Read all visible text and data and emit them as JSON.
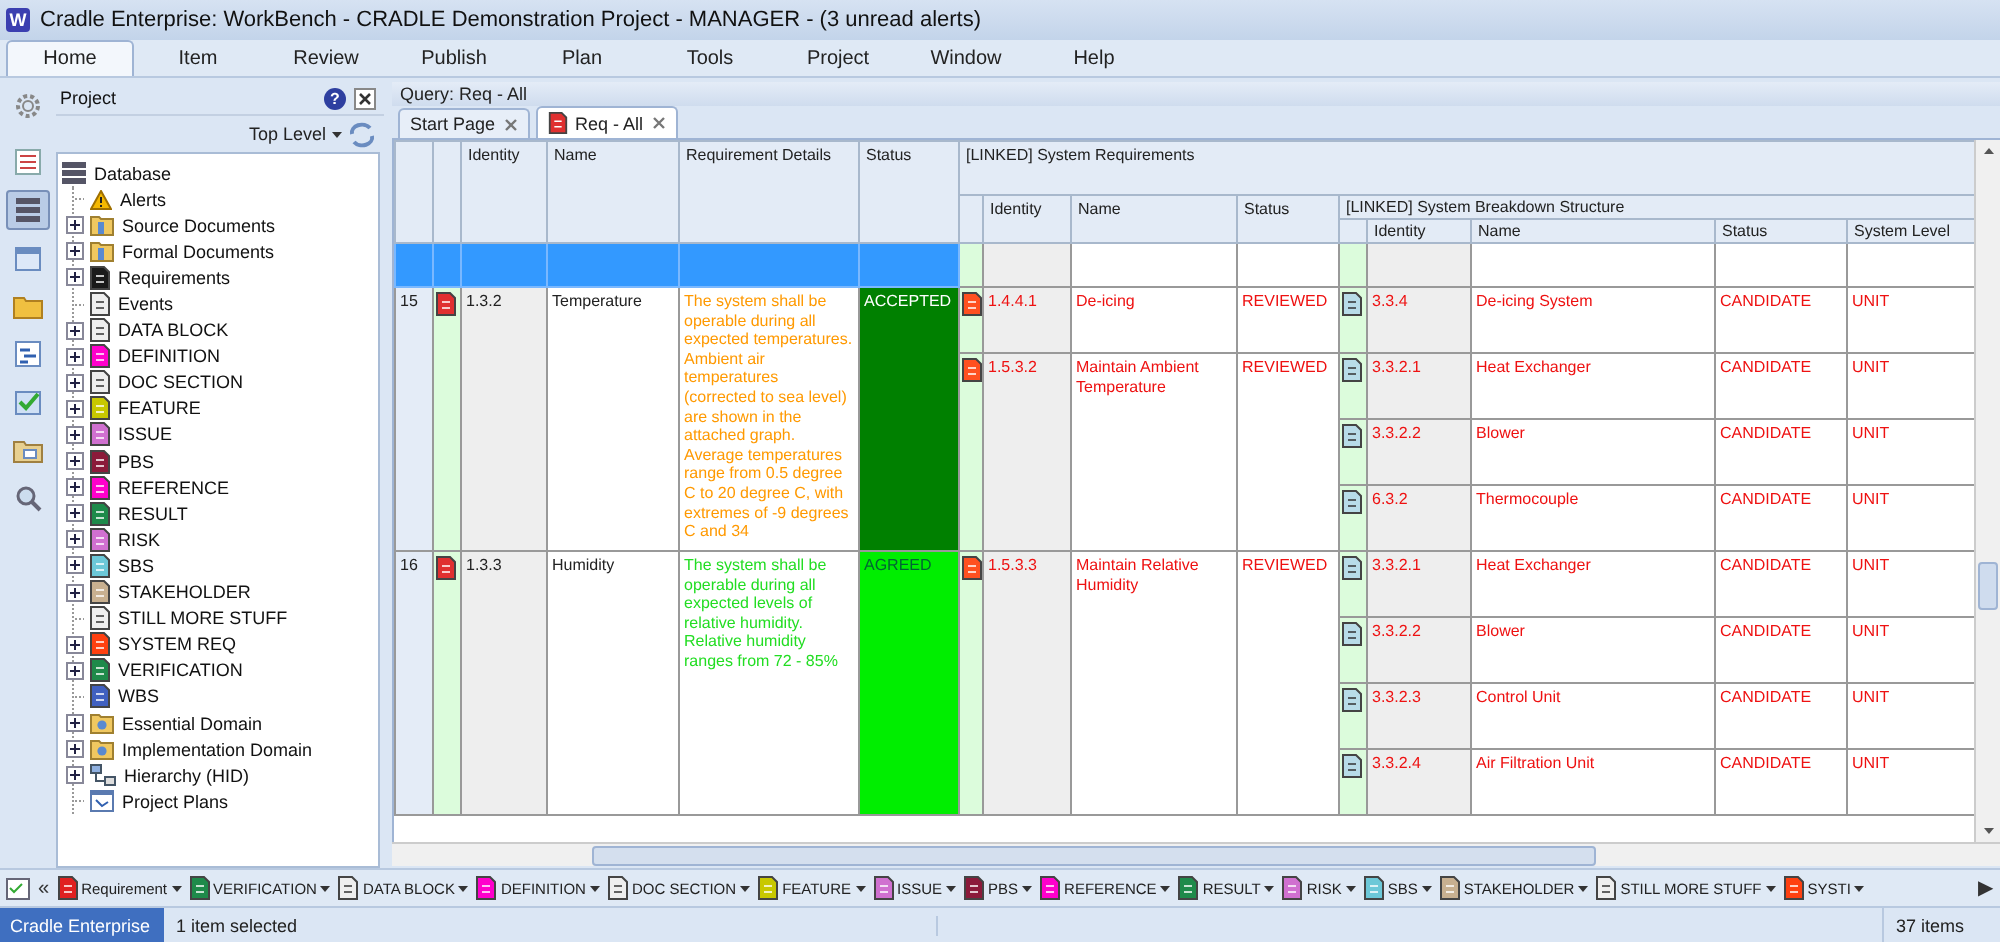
{
  "window": {
    "app_icon": "W",
    "title": "Cradle Enterprise: WorkBench - CRADLE Demonstration Project - MANAGER - (3 unread alerts)"
  },
  "ribbon_tabs": [
    {
      "label": "Home",
      "selected": true
    },
    {
      "label": "Item",
      "selected": false
    },
    {
      "label": "Review",
      "selected": false
    },
    {
      "label": "Publish",
      "selected": false
    },
    {
      "label": "Plan",
      "selected": false
    },
    {
      "label": "Tools",
      "selected": false
    },
    {
      "label": "Project",
      "selected": false
    },
    {
      "label": "Window",
      "selected": false
    },
    {
      "label": "Help",
      "selected": false
    }
  ],
  "side_tools": [
    {
      "selected": false
    },
    {
      "selected": false
    },
    {
      "selected": true
    },
    {
      "selected": false
    },
    {
      "selected": false
    },
    {
      "selected": false
    },
    {
      "selected": false
    },
    {
      "selected": false
    },
    {
      "selected": false
    }
  ],
  "project_panel": {
    "title": "Project",
    "help": "?",
    "scope": "Top Level",
    "tree": [
      {
        "label": "Database",
        "kind": "database",
        "children": [
          {
            "label": "Alerts",
            "kind": "warning",
            "collapsed": false
          },
          {
            "label": "Source Documents",
            "kind": "folder",
            "collapsed": true
          },
          {
            "label": "Formal Documents",
            "kind": "folder",
            "collapsed": true
          },
          {
            "label": "Requirements",
            "kind": "doc",
            "color": "#1a1a1a",
            "collapsed": true
          },
          {
            "label": "Events",
            "kind": "doc",
            "color": "#eeeeee",
            "collapsed": false
          },
          {
            "label": "DATA BLOCK",
            "kind": "doc",
            "color": "#eeeeee",
            "collapsed": true
          },
          {
            "label": "DEFINITION",
            "kind": "doc",
            "color": "#ff00cc",
            "collapsed": true
          },
          {
            "label": "DOC SECTION",
            "kind": "doc",
            "color": "#eeeeee",
            "collapsed": true
          },
          {
            "label": "FEATURE",
            "kind": "doc",
            "color": "#c8c800",
            "collapsed": true
          },
          {
            "label": "ISSUE",
            "kind": "doc",
            "color": "#d070d0",
            "collapsed": true
          },
          {
            "label": "PBS",
            "kind": "doc",
            "color": "#8b1a3a",
            "collapsed": true
          },
          {
            "label": "REFERENCE",
            "kind": "doc",
            "color": "#ff00cc",
            "collapsed": true
          },
          {
            "label": "RESULT",
            "kind": "doc",
            "color": "#1e8a4a",
            "collapsed": true
          },
          {
            "label": "RISK",
            "kind": "doc",
            "color": "#d070d0",
            "collapsed": true
          },
          {
            "label": "SBS",
            "kind": "doc",
            "color": "#6cc8d8",
            "collapsed": true
          },
          {
            "label": "STAKEHOLDER",
            "kind": "doc",
            "color": "#c8b090",
            "collapsed": true
          },
          {
            "label": "STILL MORE STUFF",
            "kind": "doc",
            "color": "#eeeeee",
            "collapsed": false
          },
          {
            "label": "SYSTEM REQ",
            "kind": "doc",
            "color": "#ff4010",
            "collapsed": true
          },
          {
            "label": "VERIFICATION",
            "kind": "doc",
            "color": "#1e8a4a",
            "collapsed": true
          },
          {
            "label": "WBS",
            "kind": "doc",
            "color": "#4060c0",
            "collapsed": false
          },
          {
            "label": "Essential Domain",
            "kind": "domain",
            "collapsed": true
          },
          {
            "label": "Implementation Domain",
            "kind": "domain",
            "collapsed": true
          },
          {
            "label": "Hierarchy (HID)",
            "kind": "hierarchy",
            "collapsed": true
          },
          {
            "label": "Project Plans",
            "kind": "plan",
            "collapsed": false
          }
        ]
      }
    ]
  },
  "query": "Query: Req - All",
  "doc_tabs": [
    {
      "label": "Start Page",
      "selected": false
    },
    {
      "label": "Req - All",
      "selected": true
    }
  ],
  "grid": {
    "columns": [
      "Identity",
      "Name",
      "Requirement Details",
      "Status"
    ],
    "linked_groups": [
      {
        "title": "[LINKED] System Requirements",
        "columns": [
          "Identity",
          "Name",
          "Status"
        ]
      },
      {
        "title": "[LINKED] System Breakdown Structure",
        "columns": [
          "Identity",
          "Name",
          "Status",
          "System Level"
        ]
      }
    ],
    "rows": [
      {
        "selected": true
      },
      {
        "selected": false,
        "number": "15",
        "identity": "1.3.2",
        "name": "Temperature",
        "details": {
          "text": "The system shall be operable during all expected temperatures. Ambient air temperatures (corrected to sea level) are shown in the attached graph. Average temperatures range from 0.5 degree C to 20 degree C, with extremes of -9 degrees C and 34",
          "color": "#ff9900"
        },
        "status": {
          "text": "ACCEPTED",
          "color": "#008000"
        },
        "links": [
          {
            "identity": "1.4.4.1",
            "name": "De-icing",
            "status": "REVIEWED",
            "sbs": [
              {
                "identity": "3.3.4",
                "name": "De-icing System",
                "status": "CANDIDATE",
                "system_level": "UNIT"
              }
            ]
          },
          {
            "identity": "1.5.3.2",
            "name": "Maintain Ambient Temperature",
            "status": "REVIEWED",
            "sbs": [
              {
                "identity": "3.3.2.1",
                "name": "Heat Exchanger",
                "status": "CANDIDATE",
                "system_level": "UNIT"
              },
              {
                "identity": "3.3.2.2",
                "name": "Blower",
                "status": "CANDIDATE",
                "system_level": "UNIT"
              },
              {
                "identity": "6.3.2",
                "name": "Thermocouple",
                "status": "CANDIDATE",
                "system_level": "UNIT"
              }
            ]
          }
        ]
      },
      {
        "selected": false,
        "number": "16",
        "identity": "1.3.3",
        "name": "Humidity",
        "details": {
          "text": "The system shall be operable during all expected levels of relative humidity. Relative humidity ranges from 72 - 85%",
          "color": "#22dd22"
        },
        "status": {
          "text": "AGREED",
          "color": "#00ee00"
        },
        "links": [
          {
            "identity": "1.5.3.3",
            "name": "Maintain Relative Humidity",
            "status": "REVIEWED",
            "sbs": [
              {
                "identity": "3.3.2.1",
                "name": "Heat Exchanger",
                "status": "CANDIDATE",
                "system_level": "UNIT"
              },
              {
                "identity": "3.3.2.2",
                "name": "Blower",
                "status": "CANDIDATE",
                "system_level": "UNIT"
              },
              {
                "identity": "3.3.2.3",
                "name": "Control Unit",
                "status": "CANDIDATE",
                "system_level": "UNIT"
              },
              {
                "identity": "3.3.2.4",
                "name": "Air Filtration Unit",
                "status": "CANDIDATE",
                "system_level": "UNIT"
              }
            ]
          }
        ]
      }
    ]
  },
  "type_bar": {
    "back": "«",
    "forward": "▶",
    "items": [
      {
        "label": "Requirement",
        "color": "#e02020"
      },
      {
        "label": "VERIFICATION",
        "color": "#1e8a4a"
      },
      {
        "label": "DATA BLOCK",
        "color": "#eeeeee"
      },
      {
        "label": "DEFINITION",
        "color": "#ff00cc"
      },
      {
        "label": "DOC SECTION",
        "color": "#eeeeee"
      },
      {
        "label": "FEATURE",
        "color": "#c8c800"
      },
      {
        "label": "ISSUE",
        "color": "#d070d0"
      },
      {
        "label": "PBS",
        "color": "#8b1a3a"
      },
      {
        "label": "REFERENCE",
        "color": "#ff00cc"
      },
      {
        "label": "RESULT",
        "color": "#1e8a4a"
      },
      {
        "label": "RISK",
        "color": "#d070d0"
      },
      {
        "label": "SBS",
        "color": "#6cc8d8"
      },
      {
        "label": "STAKEHOLDER",
        "color": "#c8b090"
      },
      {
        "label": "STILL MORE STUFF",
        "color": "#eeeeee"
      },
      {
        "label": "SYSTI",
        "color": "#ff4010"
      }
    ]
  },
  "status_bar": {
    "app": "Cradle Enterprise",
    "selection": "1 item selected",
    "count": "37 items"
  }
}
